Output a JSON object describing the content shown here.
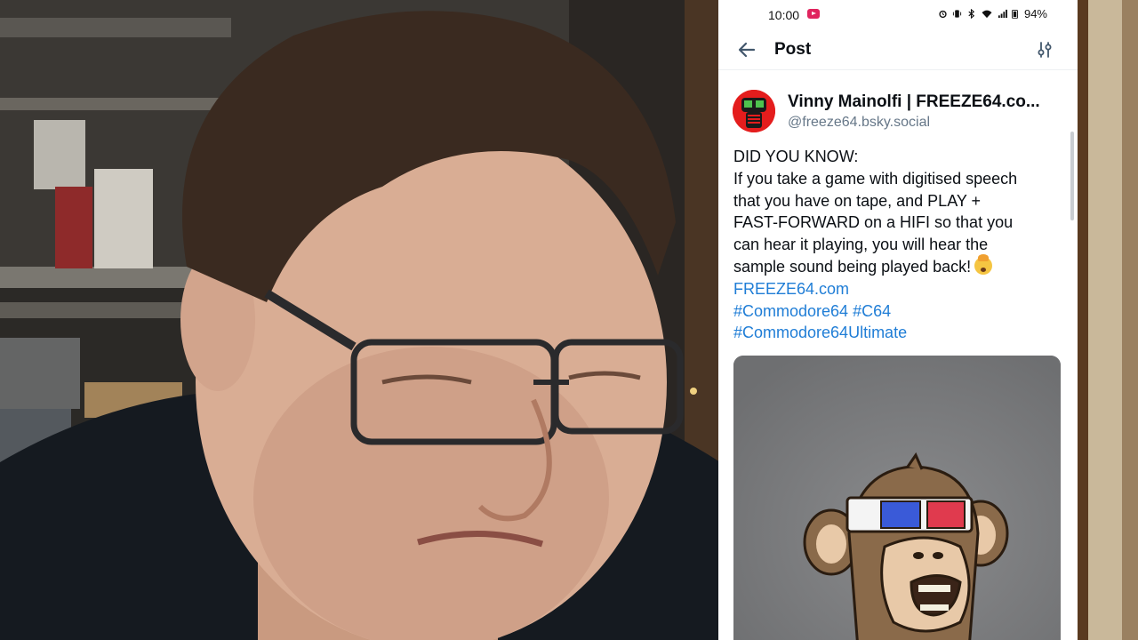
{
  "status_bar": {
    "time": "10:00",
    "battery": "94%"
  },
  "header": {
    "title": "Post",
    "back_icon": "arrow-left-icon",
    "filter_icon": "sliders-icon"
  },
  "post": {
    "author_name": "Vinny Mainolfi | FREEZE64.co...",
    "author_handle": "@freeze64.bsky.social",
    "lines": [
      "DID YOU KNOW:",
      "If you take a game with digitised speech",
      "that you have on tape, and PLAY +",
      "FAST-FORWARD on a HIFI so that you",
      "can hear it playing, you will hear the",
      "sample sound being played back!"
    ],
    "emoji": "exploding-head-emoji",
    "link": "FREEZE64.com",
    "hashtags_line1": "#Commodore64 #C64",
    "hashtags_line2": "#Commodore64Ultimate"
  },
  "colors": {
    "link": "#1f7dd6",
    "text": "#0b0f14",
    "handle": "#667788",
    "image_bg": "#7d7e80"
  }
}
